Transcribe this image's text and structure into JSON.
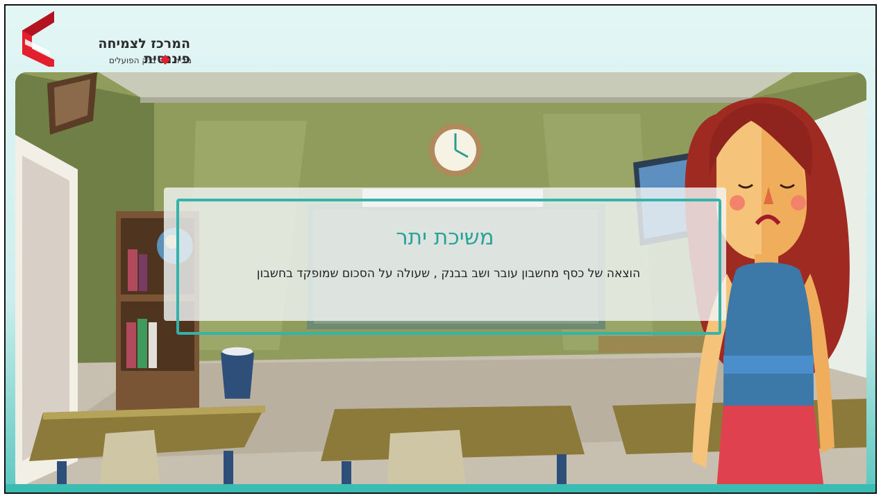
{
  "brand": {
    "title": "המרכז לצמיחה פיננסית",
    "subtitle_prefix": "מבית",
    "subtitle_bank": "בנק הפועלים",
    "accent_color": "#e31e2d"
  },
  "card": {
    "term": "משיכת יתר",
    "definition": "הוצאה של כסף מחשבון עובר ושב בבנק , שעולה על הסכום שמופקד בחשבון",
    "accent_color": "#2aa39a"
  },
  "scene": {
    "setting": "classroom-illustration",
    "character": "sad-girl-illustration"
  }
}
